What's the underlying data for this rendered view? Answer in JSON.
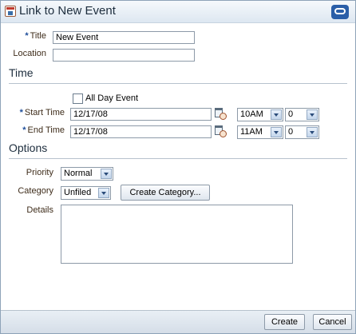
{
  "dialog": {
    "title": "Link to New Event"
  },
  "form": {
    "title_label": "Title",
    "title_value": "New Event",
    "location_label": "Location",
    "location_value": ""
  },
  "time": {
    "section_title": "Time",
    "all_day_label": "All Day Event",
    "all_day_checked": false,
    "start_label": "Start Time",
    "start_date": "12/17/08",
    "start_hour": "10AM",
    "start_minute": "0",
    "end_label": "End Time",
    "end_date": "12/17/08",
    "end_hour": "11AM",
    "end_minute": "0"
  },
  "options": {
    "section_title": "Options",
    "priority_label": "Priority",
    "priority_value": "Normal",
    "category_label": "Category",
    "category_value": "Unfiled",
    "create_category_label": "Create Category...",
    "details_label": "Details",
    "details_value": ""
  },
  "footer": {
    "create_label": "Create",
    "cancel_label": "Cancel"
  },
  "colors": {
    "required_star": "#1f4e9a",
    "label_text": "#3e2c1a",
    "title_bar": "#dde7f1"
  },
  "icons": {
    "title": "calendar-event-icon",
    "brand": "oracle-logo-icon",
    "date_picker": "calendar-clock-icon",
    "dropdown": "chevron-down-icon"
  }
}
